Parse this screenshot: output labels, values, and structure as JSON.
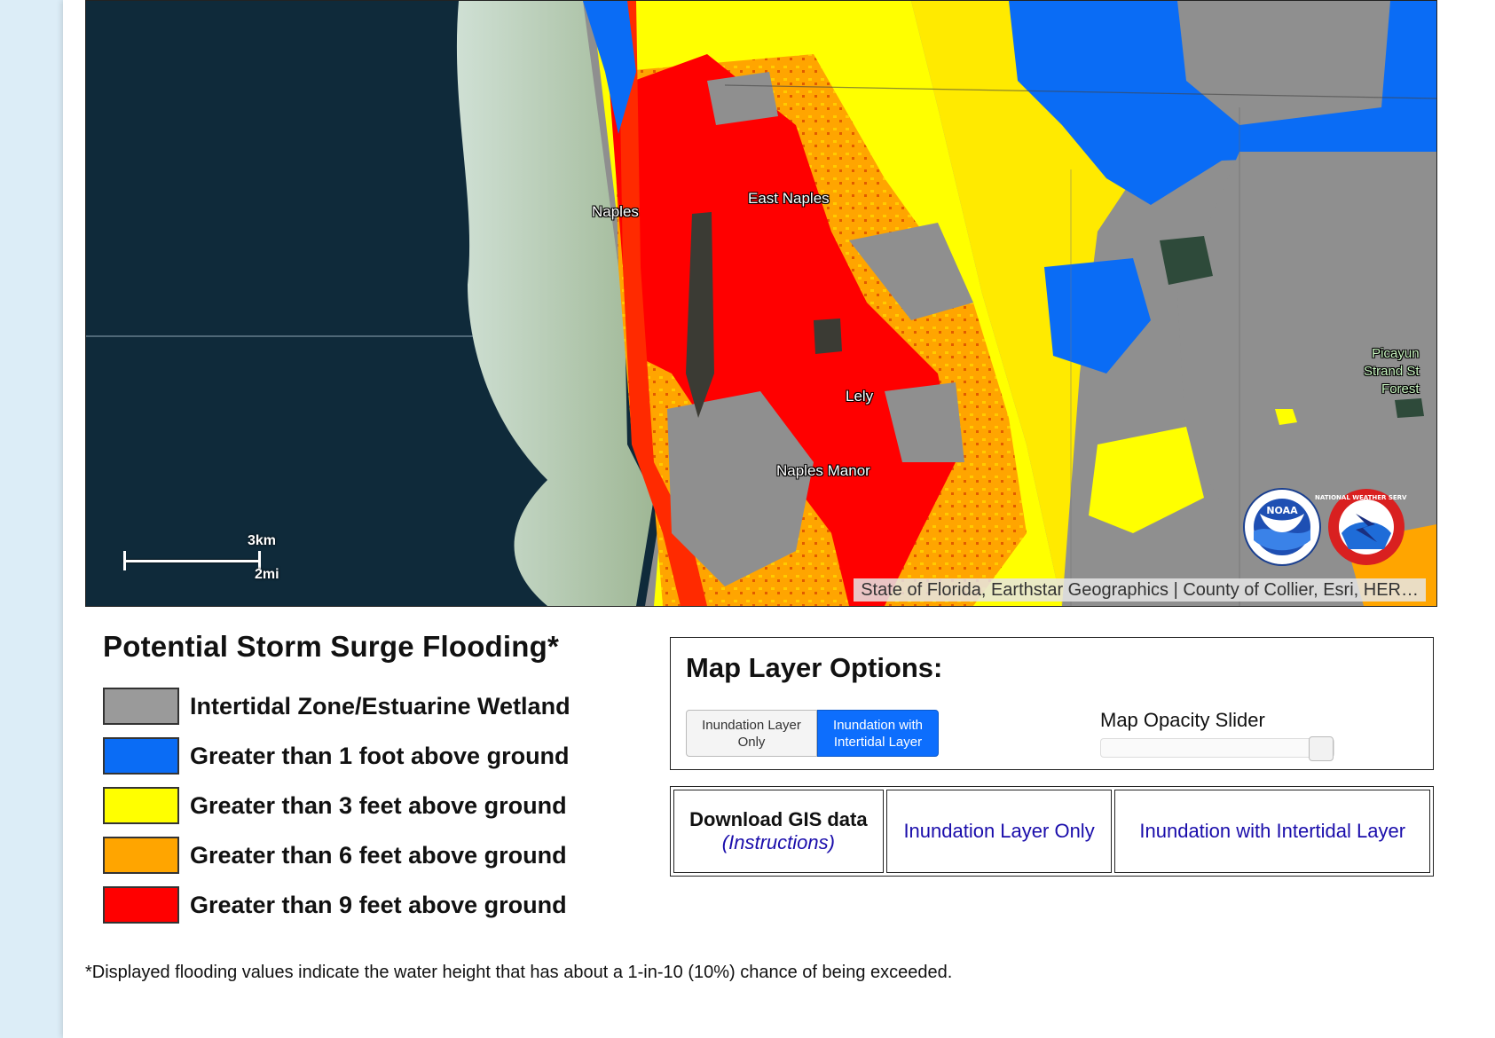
{
  "map": {
    "places": [
      "Naples",
      "East Naples",
      "Lely",
      "Naples Manor"
    ],
    "park_label_lines": [
      "Picayun",
      "Strand St",
      "Forest"
    ],
    "scale": {
      "km": "3km",
      "mi": "2mi"
    },
    "attribution": "State of Florida, Earthstar Geographics | County of Collier, Esri, HER…",
    "logos": {
      "noaa": "NOAA",
      "nws_ring": "NATIONAL WEATHER SERVICE"
    }
  },
  "legend": {
    "title": "Potential Storm Surge Flooding*",
    "items": [
      {
        "label": "Intertidal Zone/Estuarine Wetland",
        "color": "#9a9a9a"
      },
      {
        "label": "Greater than 1 foot above ground",
        "color": "#0a6cf5"
      },
      {
        "label": "Greater than 3 feet above ground",
        "color": "#ffff00"
      },
      {
        "label": "Greater than 6 feet above ground",
        "color": "#ffa500"
      },
      {
        "label": "Greater than 9 feet above ground",
        "color": "#ff0000"
      }
    ]
  },
  "footnote": "*Displayed flooding values indicate the water height that has about a 1-in-10 (10%) chance of being exceeded.",
  "layer_options": {
    "title": "Map Layer Options:",
    "toggle": {
      "inundation_only": "Inundation Layer Only",
      "inundation_intertidal": "Inundation with Intertidal Layer"
    },
    "active": "inundation_intertidal",
    "opacity_label": "Map Opacity Slider",
    "opacity_value": 1.0
  },
  "downloads": {
    "title": "Download GIS data",
    "instructions": "(Instructions)",
    "inundation_only": "Inundation Layer Only",
    "inundation_intertidal": "Inundation with Intertidal Layer"
  }
}
